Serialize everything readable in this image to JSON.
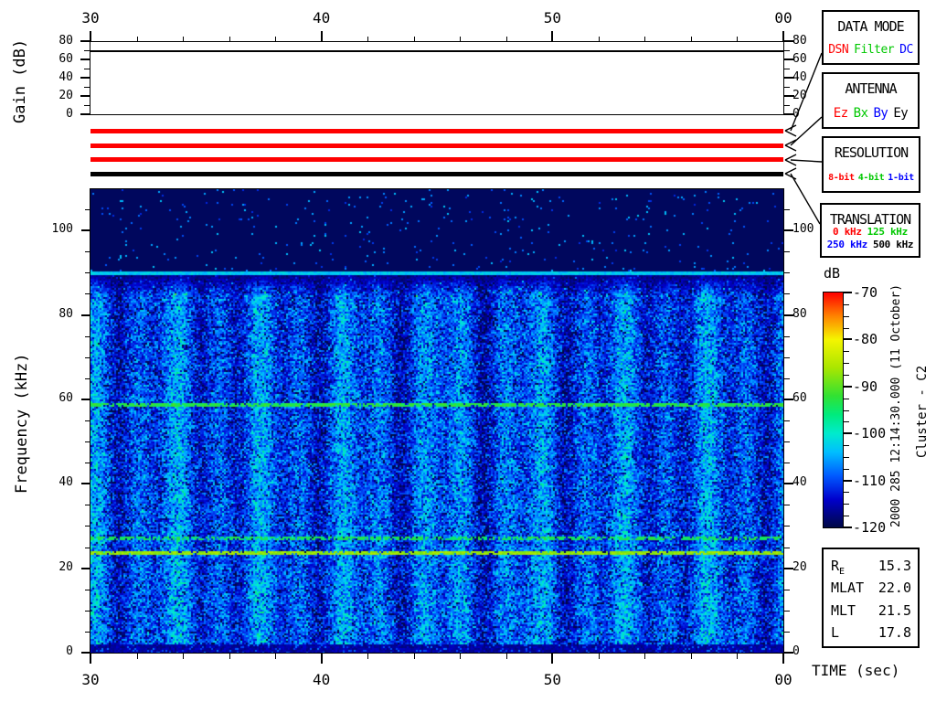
{
  "colors": {
    "red": "#ff0000",
    "green": "#00c800",
    "blue": "#0000ff",
    "black": "#000000"
  },
  "gain_plot": {
    "ylabel": "Gain (dB)"
  },
  "spectrogram_plot": {
    "ylabel": "Frequency (kHz)",
    "xlabel": "TIME (sec)"
  },
  "colorbar_label": "dB",
  "side_annotations": {
    "datetime": "2000 285 12:14:30.000 (11 October)",
    "spacecraft": "Cluster - C2"
  },
  "panels": {
    "data_mode": {
      "title": "DATA MODE",
      "options": [
        {
          "label": "DSN",
          "color": "#ff0000"
        },
        {
          "label": "Filter",
          "color": "#00c800"
        },
        {
          "label": "DC",
          "color": "#0000ff"
        }
      ]
    },
    "antenna": {
      "title": "ANTENNA",
      "options": [
        {
          "label": "Ez",
          "color": "#ff0000"
        },
        {
          "label": "Bx",
          "color": "#00c800"
        },
        {
          "label": "By",
          "color": "#0000ff"
        },
        {
          "label": "Ey",
          "color": "#000000"
        }
      ]
    },
    "resolution": {
      "title": "RESOLUTION",
      "options": [
        {
          "label": "8-bit",
          "color": "#ff0000"
        },
        {
          "label": "4-bit",
          "color": "#00c800"
        },
        {
          "label": "1-bit",
          "color": "#0000ff"
        }
      ]
    },
    "translation": {
      "title": "TRANSLATION",
      "options": [
        {
          "label": "0 kHz",
          "color": "#ff0000"
        },
        {
          "label": "125 kHz",
          "color": "#00c800"
        },
        {
          "label": "250 kHz",
          "color": "#0000ff"
        },
        {
          "label": "500 kHz",
          "color": "#000000"
        }
      ]
    }
  },
  "status_bars": [
    {
      "name": "data-mode-bar",
      "color": "#ff0000"
    },
    {
      "name": "antenna-bar",
      "color": "#ff0000"
    },
    {
      "name": "resolution-bar",
      "color": "#ff0000"
    },
    {
      "name": "translation-bar",
      "color": "#000000"
    }
  ],
  "ephemeris": {
    "rows": [
      {
        "label": "R",
        "sub": "E",
        "value": "15.3"
      },
      {
        "label": "MLAT",
        "sub": "",
        "value": "22.0"
      },
      {
        "label": "MLT",
        "sub": "",
        "value": "21.5"
      },
      {
        "label": "L",
        "sub": "",
        "value": "17.8"
      }
    ]
  },
  "chart_data": [
    {
      "type": "line",
      "name": "gain-panel",
      "ylabel": "Gain (dB)",
      "ylim": [
        0,
        80
      ],
      "y_tick_labels": [
        "80",
        "60",
        "40",
        "20",
        "0"
      ],
      "y_tick_values": [
        80,
        60,
        40,
        20,
        0
      ],
      "y_minor_step_db": 10,
      "x_range_sec": [
        30,
        60
      ],
      "x_tick_labels": [
        "30",
        "40",
        "50",
        "00"
      ],
      "x_minor_step_sec": 2,
      "grid": false,
      "series": [
        {
          "name": "receiver gain",
          "shape": "constant",
          "value_db": 70
        }
      ]
    },
    {
      "type": "heatmap",
      "name": "wbd-spectrogram",
      "xlabel": "TIME (sec)",
      "ylabel": "Frequency (kHz)",
      "ylim_khz": [
        0,
        110
      ],
      "y_tick_labels": [
        "100",
        "80",
        "60",
        "40",
        "20",
        "0"
      ],
      "y_tick_values_khz": [
        100,
        80,
        60,
        40,
        20,
        0
      ],
      "y_minor_step_khz": 5,
      "x_range_sec": [
        30,
        60
      ],
      "x_tick_labels": [
        "30",
        "40",
        "50",
        "00"
      ],
      "x_minor_step_sec": 2,
      "colorbar": {
        "label": "dB",
        "max_db": -70,
        "min_db": -120,
        "tick_labels": [
          "-70",
          "-80",
          "-90",
          "-100",
          "-110",
          "-120"
        ],
        "minor_step_db": 2.5,
        "palette_stops": [
          [
            -120,
            0,
            8,
            70
          ],
          [
            -114,
            0,
            0,
            205
          ],
          [
            -109,
            0,
            90,
            255
          ],
          [
            -104,
            0,
            190,
            255
          ],
          [
            -100,
            0,
            235,
            205
          ],
          [
            -96,
            0,
            235,
            125
          ],
          [
            -92,
            50,
            225,
            50
          ],
          [
            -86,
            170,
            230,
            0
          ],
          [
            -80,
            245,
            245,
            0
          ],
          [
            -75,
            255,
            130,
            0
          ],
          [
            -70,
            255,
            0,
            0
          ]
        ]
      },
      "noise_floor_db": -110,
      "noise_sigma_db": 6.5,
      "vertical_band_period_sec": 1.76,
      "vertical_band_amplitude_db": 5.5,
      "quiet_above_khz": 90.6,
      "quiet_level_db": -119,
      "fade_start_khz": 84.5,
      "bottom_quiet_below_khz": 1.9,
      "spectral_lines": [
        {
          "freq_khz": 90.1,
          "level_db": -103,
          "width_khz": 0.9,
          "density": 1.0
        },
        {
          "freq_khz": 58.8,
          "level_db": -93,
          "width_khz": 0.9,
          "density": 0.8
        },
        {
          "freq_khz": 27.1,
          "level_db": -94,
          "width_khz": 0.7,
          "density": 0.65
        },
        {
          "freq_khz": 23.6,
          "level_db": -87,
          "width_khz": 0.7,
          "density": 0.9
        }
      ]
    }
  ]
}
